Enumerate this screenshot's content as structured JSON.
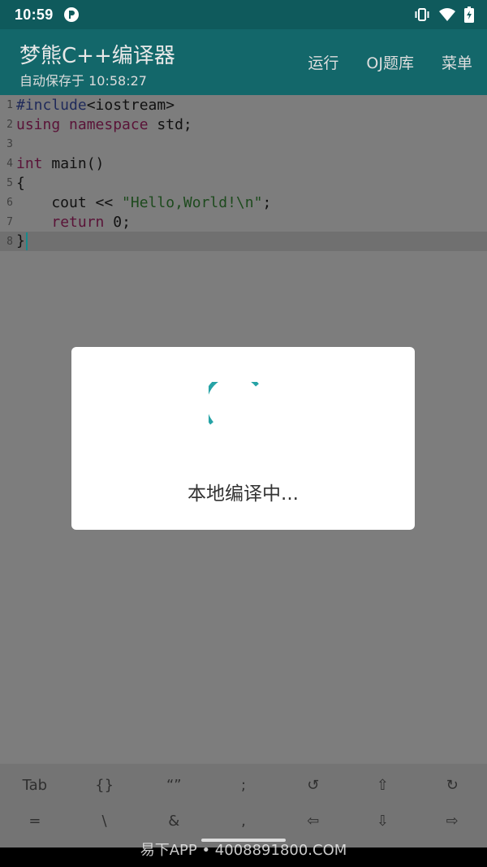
{
  "status": {
    "time": "10:59"
  },
  "app_bar": {
    "title": "梦熊C++编译器",
    "subtitle": "自动保存于 10:58:27",
    "actions": {
      "run": "运行",
      "oj": "OJ题库",
      "menu": "菜单"
    }
  },
  "editor": {
    "line_numbers": [
      "1",
      "2",
      "3",
      "4",
      "5",
      "6",
      "7",
      "8"
    ],
    "lines": {
      "l1_pre": "#include",
      "l1_rest": "<iostream>",
      "l2_kw1": "using",
      "l2_kw2": "namespace",
      "l2_rest": "std;",
      "l4_kw": "int",
      "l4_rest": "main()",
      "l5": "{",
      "l6_a": "    cout << ",
      "l6_str": "\"Hello,World!\\n\"",
      "l6_b": ";",
      "l7_kw": "return",
      "l7_rest": " 0;",
      "l8": "}"
    }
  },
  "dialog": {
    "message": "本地编译中..."
  },
  "extra_keys": {
    "row1": [
      "Tab",
      "{}",
      "“”",
      ";",
      "↺",
      "⇧",
      "↻"
    ],
    "row2": [
      "=",
      "\\",
      "&",
      ",",
      "⇦",
      "⇩",
      "⇨"
    ]
  },
  "watermark": "易下APP • 4008891800.COM",
  "colors": {
    "accent": "#13676a",
    "status_bar": "#0f5a5c",
    "spinner": "#26a3a6"
  }
}
